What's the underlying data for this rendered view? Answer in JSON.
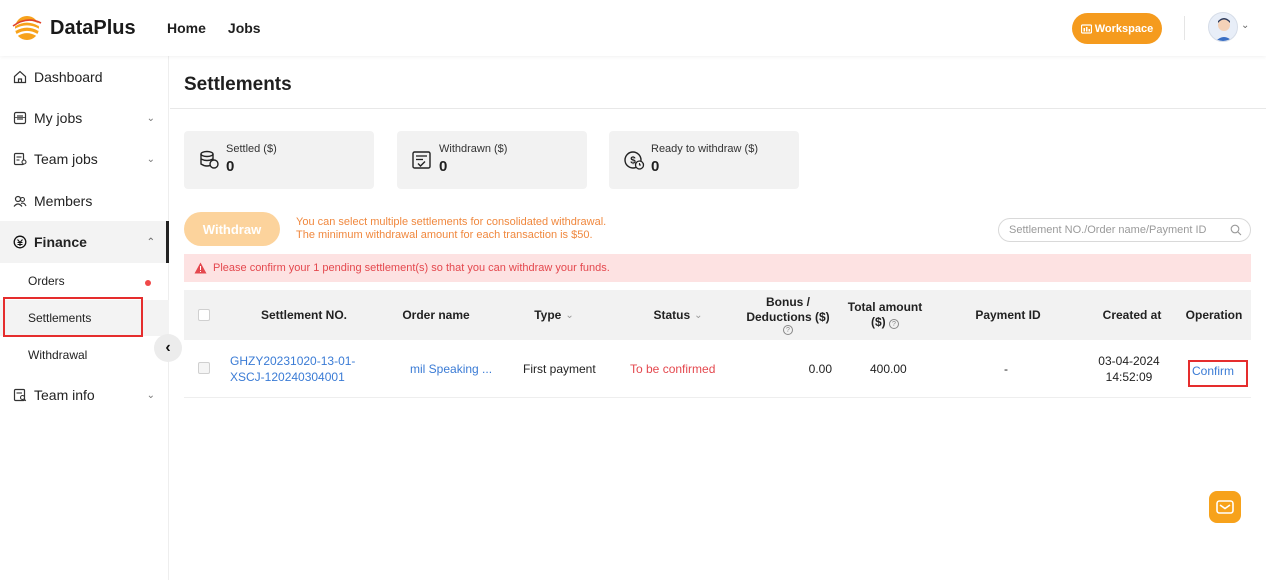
{
  "app": {
    "name": "DataPlus"
  },
  "topnav": {
    "home": "Home",
    "jobs": "Jobs",
    "workspace": "Workspace"
  },
  "sidebar": {
    "dashboard": "Dashboard",
    "my_jobs": "My jobs",
    "team_jobs": "Team jobs",
    "members": "Members",
    "finance": "Finance",
    "finance_children": [
      "Orders",
      "Settlements",
      "Withdrawal"
    ],
    "team_info": "Team info"
  },
  "page": {
    "title": "Settlements"
  },
  "stats": [
    {
      "label": "Settled ($)",
      "value": "0",
      "icon": "coins-stack-icon"
    },
    {
      "label": "Withdrawn ($)",
      "value": "0",
      "icon": "receipt-check-icon"
    },
    {
      "label": "Ready to withdraw ($)",
      "value": "0",
      "icon": "money-clock-icon"
    }
  ],
  "withdraw": {
    "button": "Withdraw",
    "note_line1": "You can select multiple settlements for consolidated withdrawal.",
    "note_line2": "The minimum withdrawal amount for each transaction is $50."
  },
  "search": {
    "placeholder": "Settlement NO./Order name/Payment ID"
  },
  "alert": {
    "text": "Please confirm your 1 pending settlement(s) so that you can withdraw your funds."
  },
  "table": {
    "headers": {
      "settlement_no": "Settlement NO.",
      "order_name": "Order name",
      "type": "Type",
      "status": "Status",
      "bonus_line1": "Bonus /",
      "bonus_line2": "Deductions ($)",
      "total_line1": "Total amount",
      "total_line2": "($)",
      "payment_id": "Payment ID",
      "created_at": "Created at",
      "operation": "Operation"
    },
    "rows": [
      {
        "settlement_no_line1": "GHZY20231020-13-01-",
        "settlement_no_line2": "XSCJ-120240304001",
        "order_name": "mil Speaking ...",
        "type": "First payment",
        "status": "To be confirmed",
        "bonus": "0.00",
        "total": "400.00",
        "payment_id": "-",
        "created_date": "03-04-2024",
        "created_time": "14:52:09",
        "operation": "Confirm"
      }
    ]
  },
  "colors": {
    "accent": "#f59b1e",
    "link": "#3a7bd5",
    "danger": "#e4484e",
    "highlight": "#e52d2d"
  }
}
